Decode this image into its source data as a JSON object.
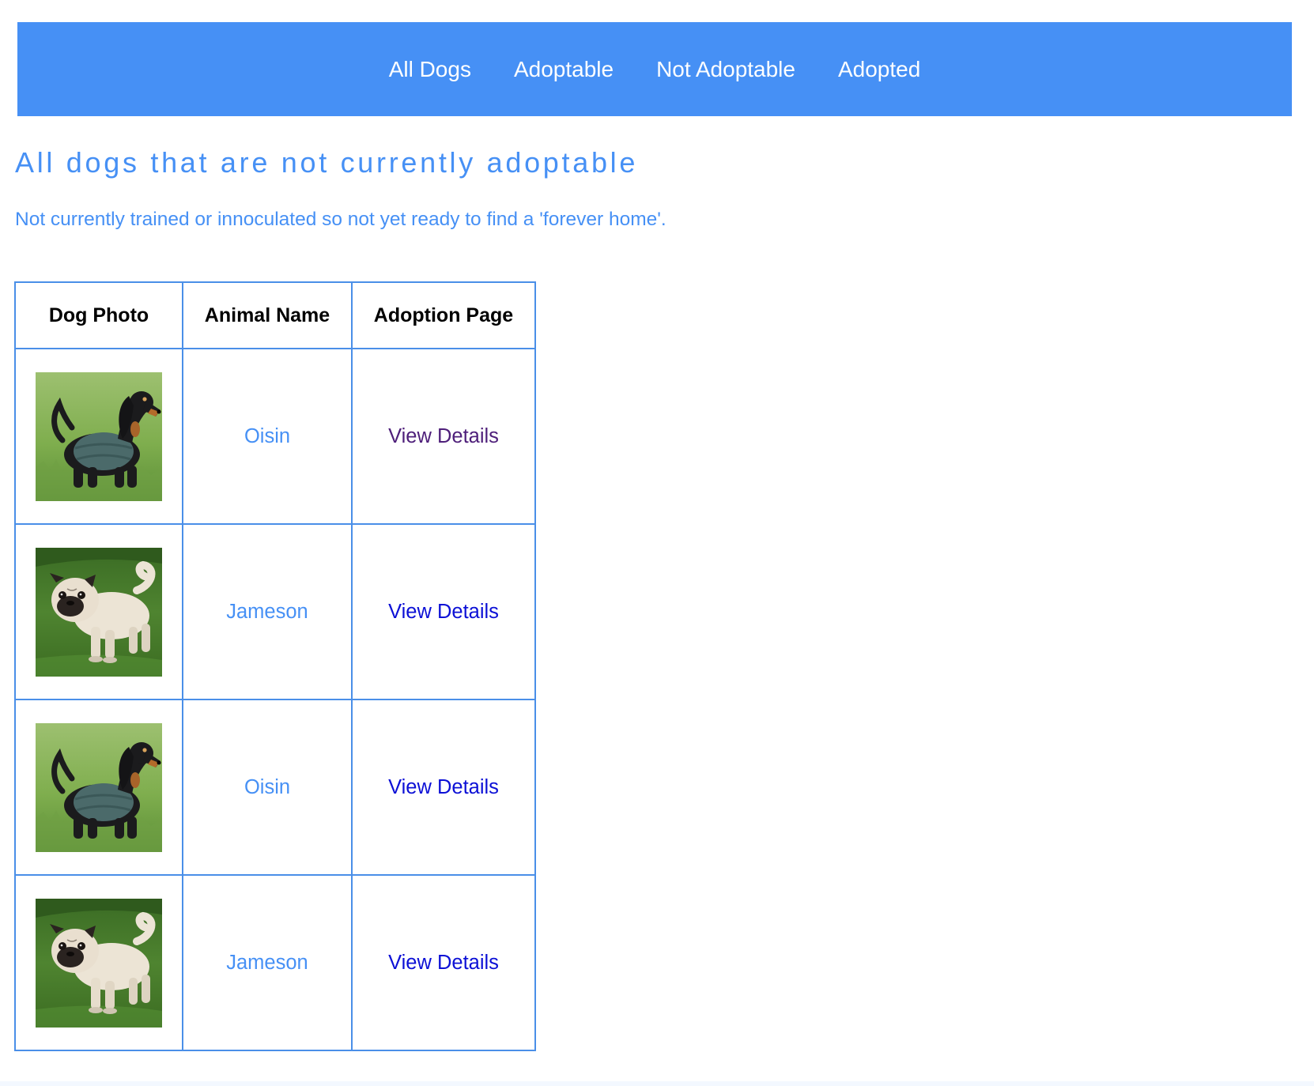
{
  "nav": {
    "items": [
      {
        "label": "All Dogs"
      },
      {
        "label": "Adoptable"
      },
      {
        "label": "Not Adoptable"
      },
      {
        "label": "Adopted"
      }
    ]
  },
  "page": {
    "title": "All dogs that are not currently adoptable",
    "subtitle": "Not currently trained or innoculated so not yet ready to find a 'forever home'."
  },
  "table": {
    "headers": [
      "Dog Photo",
      "Animal Name",
      "Adoption Page"
    ],
    "rows": [
      {
        "photo_icon": "dachshund-photo",
        "name": "Oisin",
        "link": "View Details",
        "visited": true
      },
      {
        "photo_icon": "pug-photo",
        "name": "Jameson",
        "link": "View Details",
        "visited": false
      },
      {
        "photo_icon": "dachshund-photo",
        "name": "Oisin",
        "link": "View Details",
        "visited": false
      },
      {
        "photo_icon": "pug-photo",
        "name": "Jameson",
        "link": "View Details",
        "visited": false
      }
    ]
  },
  "colors": {
    "accent": "#4690f5",
    "link": "#0c10d6",
    "visited_link": "#4e1f7a",
    "table_border": "#4a8fe8"
  }
}
